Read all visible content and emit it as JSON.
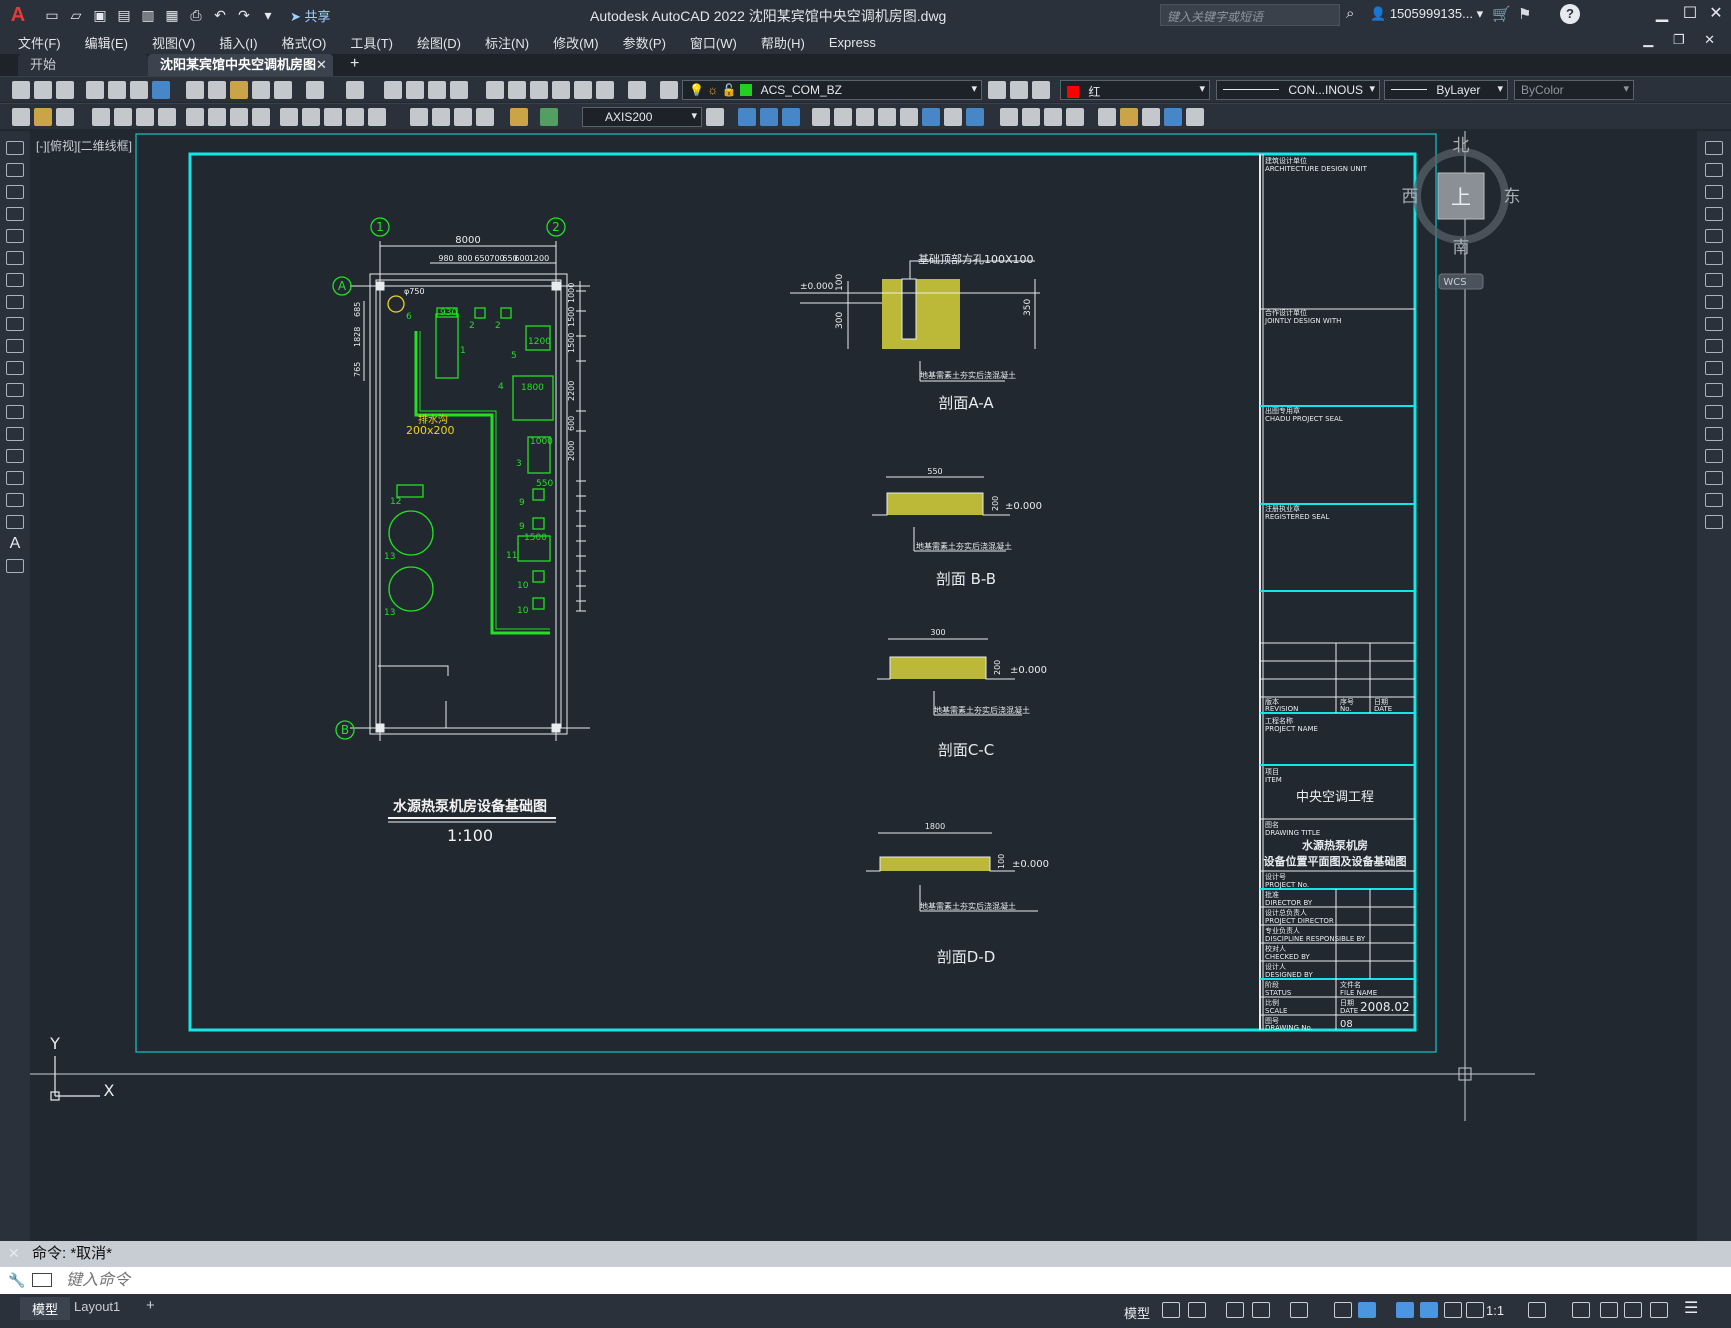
{
  "titlebar": {
    "logo": "A",
    "share_label": "共享",
    "app_title": "Autodesk AutoCAD 2022    沈阳某宾馆中央空调机房图.dwg",
    "search_placeholder": "键入关键字或短语",
    "user": "1505999135...",
    "help": "?"
  },
  "menu": [
    "文件(F)",
    "编辑(E)",
    "视图(V)",
    "插入(I)",
    "格式(O)",
    "工具(T)",
    "绘图(D)",
    "标注(N)",
    "修改(M)",
    "参数(P)",
    "窗口(W)",
    "帮助(H)",
    "Express"
  ],
  "tabs": {
    "start": "开始",
    "doc": "沈阳某宾馆中央空调机房图*",
    "close": "✕",
    "add": "+"
  },
  "toolbar": {
    "layer": "ACS_COM_BZ",
    "color": "红",
    "color_hex": "#ff0000",
    "linetype": "CON...INOUS",
    "lineweight": "ByLayer",
    "plotstyle": "ByColor",
    "dimstyle": "AXIS200"
  },
  "viewport": {
    "label": "[-][俯视][二维线框]",
    "compass": {
      "north": "北",
      "south": "南",
      "east": "东",
      "west": "西",
      "top": "上"
    },
    "wcs": "WCS"
  },
  "drawing": {
    "plan_title": "水源热泵机房设备基础图",
    "plan_scale": "1:100",
    "axis_labels": [
      "1",
      "2",
      "A",
      "B"
    ],
    "dim_total": "8000",
    "dims_top": [
      "980",
      "800",
      "650",
      "700",
      "650",
      "600",
      "1200"
    ],
    "dims_right": [
      "1000",
      "1500",
      "1500",
      "2200",
      "600",
      "2000"
    ],
    "dims_left": [
      "685",
      "1828",
      "765"
    ],
    "pipe_dia": "φ750",
    "trench_label": "排水沟",
    "trench_size": "200x200",
    "equip_sizes": [
      "930",
      "1200",
      "1800",
      "1000",
      "550",
      "1500"
    ],
    "equip_numbers": [
      "1",
      "2",
      "2",
      "3",
      "4",
      "5",
      "6",
      "9",
      "9",
      "10",
      "10",
      "11",
      "12",
      "13",
      "13"
    ],
    "section_a": {
      "title": "剖面A-A",
      "size": "基础顶部方孔100X100",
      "level": "±0.000",
      "dims": [
        "100",
        "300",
        "350"
      ],
      "note": "地基需素土夯实后浇混凝土"
    },
    "section_b": {
      "title": "剖面 B-B",
      "width": "550",
      "height": "200",
      "level": "±0.000",
      "note": "地基需素土夯实后浇混凝土"
    },
    "section_c": {
      "title": "剖面C-C",
      "width": "300",
      "height": "200",
      "level": "±0.000",
      "note": "地基需素土夯实后浇混凝土"
    },
    "section_d": {
      "title": "剖面D-D",
      "width": "1800",
      "height": "100",
      "level": "±0.000",
      "note": "地基需素土夯实后浇混凝土"
    }
  },
  "titleblock": {
    "design_unit_cn": "建筑设计单位",
    "design_unit_en": "ARCHITECTURE DESIGN UNIT",
    "joint_cn": "合作设计单位",
    "joint_en": "JOINTLY DESIGN WITH",
    "seal_cn": "出图专用章",
    "seal_en": "CHADU PROJECT SEAL",
    "reg_cn": "注册执业章",
    "reg_en": "REGISTERED SEAL",
    "revision_cn": "版本",
    "revision_en": "REVISION",
    "no_cn": "序号",
    "no_en": "No.",
    "date_cn": "日期",
    "date_en": "DATE",
    "project_cn": "工程名称",
    "project_en": "PROJECT NAME",
    "item_cn": "项目",
    "item_en": "ITEM",
    "item_value": "中央空调工程",
    "drawing_title_cn": "图名",
    "drawing_title_en": "DRAWING TITLE",
    "drawing_title_1": "水源热泵机房",
    "drawing_title_2": "设备位置平面图及设备基础图",
    "project_no_cn": "设计号",
    "project_no_en": "PROJECT No.",
    "approved_cn": "批准",
    "approved_en": "DIRECTOR BY",
    "director_cn": "设计总负责人",
    "director_en": "PROJECT DIRECTOR",
    "discipline_cn": "专业负责人",
    "discipline_en": "DISCIPLINE RESPONSIBLE BY",
    "checked_cn": "校对人",
    "checked_en": "CHECKED BY",
    "designed_cn": "设计人",
    "designed_en": "DESIGNED BY",
    "status_cn": "阶段",
    "status_en": "STATUS",
    "filename_cn": "文件名",
    "filename_en": "FILE NAME",
    "scale_cn": "比例",
    "scale_en": "SCALE",
    "date2_cn": "日期",
    "date2_en": "DATE",
    "date_value": "2008.02",
    "drawing_no_cn": "图号",
    "drawing_no_en": "DRAWING No.",
    "drawing_no_value": "08"
  },
  "ucs": {
    "x": "X",
    "y": "Y"
  },
  "command": {
    "history": "命令: *取消*",
    "placeholder": "键入命令"
  },
  "status": {
    "tab_model": "模型",
    "tab_layout": "Layout1",
    "add": "+",
    "model_label": "模型",
    "scale": "1:1"
  }
}
